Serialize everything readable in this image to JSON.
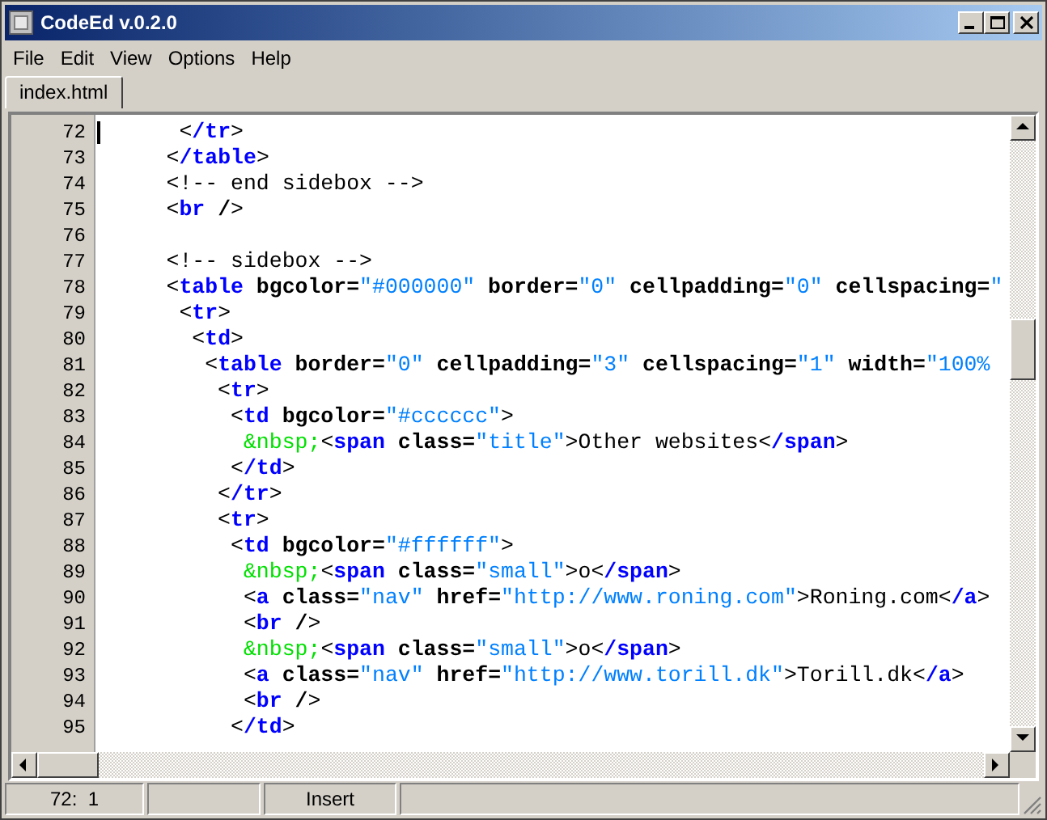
{
  "window": {
    "title": "CodeEd v.0.2.0"
  },
  "menu": [
    {
      "label": "File"
    },
    {
      "label": "Edit"
    },
    {
      "label": "View"
    },
    {
      "label": "Options"
    },
    {
      "label": "Help"
    }
  ],
  "tabs": [
    {
      "label": "index.html",
      "selected": true
    }
  ],
  "editor": {
    "lines": [
      {
        "number": "72",
        "tokens": [
          {
            "kind": "punct",
            "text": "      <"
          },
          {
            "kind": "tag",
            "text": "/tr"
          },
          {
            "kind": "punct",
            "text": ">"
          }
        ]
      },
      {
        "number": "73",
        "tokens": [
          {
            "kind": "punct",
            "text": "     <"
          },
          {
            "kind": "tag",
            "text": "/table"
          },
          {
            "kind": "punct",
            "text": ">"
          }
        ]
      },
      {
        "number": "74",
        "tokens": [
          {
            "kind": "text",
            "text": "     <!-- end sidebox -->"
          }
        ]
      },
      {
        "number": "75",
        "tokens": [
          {
            "kind": "punct",
            "text": "     <"
          },
          {
            "kind": "tag",
            "text": "br"
          },
          {
            "kind": "attr",
            "text": " /"
          },
          {
            "kind": "punct",
            "text": ">"
          }
        ]
      },
      {
        "number": "76"
      },
      {
        "number": "77",
        "tokens": [
          {
            "kind": "text",
            "text": "     <!-- sidebox -->"
          }
        ]
      },
      {
        "number": "78",
        "tokens": [
          {
            "kind": "punct",
            "text": "     <"
          },
          {
            "kind": "tag",
            "text": "table"
          },
          {
            "kind": "attr",
            "text": " bgcolor="
          },
          {
            "kind": "string",
            "text": "\"#000000\""
          },
          {
            "kind": "attr",
            "text": " border="
          },
          {
            "kind": "string",
            "text": "\"0\""
          },
          {
            "kind": "attr",
            "text": " cellpadding="
          },
          {
            "kind": "string",
            "text": "\"0\""
          },
          {
            "kind": "attr",
            "text": " cellspacing="
          },
          {
            "kind": "string",
            "text": "\""
          }
        ]
      },
      {
        "number": "79",
        "tokens": [
          {
            "kind": "punct",
            "text": "      <"
          },
          {
            "kind": "tag",
            "text": "tr"
          },
          {
            "kind": "punct",
            "text": ">"
          }
        ]
      },
      {
        "number": "80",
        "tokens": [
          {
            "kind": "punct",
            "text": "       <"
          },
          {
            "kind": "tag",
            "text": "td"
          },
          {
            "kind": "punct",
            "text": ">"
          }
        ]
      },
      {
        "number": "81",
        "tokens": [
          {
            "kind": "punct",
            "text": "        <"
          },
          {
            "kind": "tag",
            "text": "table"
          },
          {
            "kind": "attr",
            "text": " border="
          },
          {
            "kind": "string",
            "text": "\"0\""
          },
          {
            "kind": "attr",
            "text": " cellpadding="
          },
          {
            "kind": "string",
            "text": "\"3\""
          },
          {
            "kind": "attr",
            "text": " cellspacing="
          },
          {
            "kind": "string",
            "text": "\"1\""
          },
          {
            "kind": "attr",
            "text": " width="
          },
          {
            "kind": "string",
            "text": "\"100%"
          }
        ]
      },
      {
        "number": "82",
        "tokens": [
          {
            "kind": "punct",
            "text": "         <"
          },
          {
            "kind": "tag",
            "text": "tr"
          },
          {
            "kind": "punct",
            "text": ">"
          }
        ]
      },
      {
        "number": "83",
        "tokens": [
          {
            "kind": "punct",
            "text": "          <"
          },
          {
            "kind": "tag",
            "text": "td"
          },
          {
            "kind": "attr",
            "text": " bgcolor="
          },
          {
            "kind": "string",
            "text": "\"#cccccc\""
          },
          {
            "kind": "punct",
            "text": ">"
          }
        ]
      },
      {
        "number": "84",
        "tokens": [
          {
            "kind": "entity",
            "text": "           &nbsp;"
          },
          {
            "kind": "punct",
            "text": "<"
          },
          {
            "kind": "tag",
            "text": "span"
          },
          {
            "kind": "attr",
            "text": " class="
          },
          {
            "kind": "string",
            "text": "\"title\""
          },
          {
            "kind": "text",
            "text": ">Other websites<"
          },
          {
            "kind": "tag",
            "text": "/span"
          },
          {
            "kind": "punct",
            "text": ">"
          }
        ]
      },
      {
        "number": "85",
        "tokens": [
          {
            "kind": "punct",
            "text": "          <"
          },
          {
            "kind": "tag",
            "text": "/td"
          },
          {
            "kind": "punct",
            "text": ">"
          }
        ]
      },
      {
        "number": "86",
        "tokens": [
          {
            "kind": "punct",
            "text": "         <"
          },
          {
            "kind": "tag",
            "text": "/tr"
          },
          {
            "kind": "punct",
            "text": ">"
          }
        ]
      },
      {
        "number": "87",
        "tokens": [
          {
            "kind": "punct",
            "text": "         <"
          },
          {
            "kind": "tag",
            "text": "tr"
          },
          {
            "kind": "punct",
            "text": ">"
          }
        ]
      },
      {
        "number": "88",
        "tokens": [
          {
            "kind": "punct",
            "text": "          <"
          },
          {
            "kind": "tag",
            "text": "td"
          },
          {
            "kind": "attr",
            "text": " bgcolor="
          },
          {
            "kind": "string",
            "text": "\"#ffffff\""
          },
          {
            "kind": "punct",
            "text": ">"
          }
        ]
      },
      {
        "number": "89",
        "tokens": [
          {
            "kind": "entity",
            "text": "           &nbsp;"
          },
          {
            "kind": "punct",
            "text": "<"
          },
          {
            "kind": "tag",
            "text": "span"
          },
          {
            "kind": "attr",
            "text": " class="
          },
          {
            "kind": "string",
            "text": "\"small\""
          },
          {
            "kind": "text",
            "text": ">o<"
          },
          {
            "kind": "tag",
            "text": "/span"
          },
          {
            "kind": "punct",
            "text": ">"
          }
        ]
      },
      {
        "number": "90",
        "tokens": [
          {
            "kind": "punct",
            "text": "           <"
          },
          {
            "kind": "tag",
            "text": "a"
          },
          {
            "kind": "attr",
            "text": " class="
          },
          {
            "kind": "string",
            "text": "\"nav\""
          },
          {
            "kind": "attr",
            "text": " href="
          },
          {
            "kind": "string",
            "text": "\"http://www.roning.com\""
          },
          {
            "kind": "text",
            "text": ">Roning.com<"
          },
          {
            "kind": "tag",
            "text": "/a"
          },
          {
            "kind": "punct",
            "text": ">"
          }
        ]
      },
      {
        "number": "91",
        "tokens": [
          {
            "kind": "punct",
            "text": "           <"
          },
          {
            "kind": "tag",
            "text": "br"
          },
          {
            "kind": "attr",
            "text": " /"
          },
          {
            "kind": "punct",
            "text": ">"
          }
        ]
      },
      {
        "number": "92",
        "tokens": [
          {
            "kind": "entity",
            "text": "           &nbsp;"
          },
          {
            "kind": "punct",
            "text": "<"
          },
          {
            "kind": "tag",
            "text": "span"
          },
          {
            "kind": "attr",
            "text": " class="
          },
          {
            "kind": "string",
            "text": "\"small\""
          },
          {
            "kind": "text",
            "text": ">o<"
          },
          {
            "kind": "tag",
            "text": "/span"
          },
          {
            "kind": "punct",
            "text": ">"
          }
        ]
      },
      {
        "number": "93",
        "tokens": [
          {
            "kind": "punct",
            "text": "           <"
          },
          {
            "kind": "tag",
            "text": "a"
          },
          {
            "kind": "attr",
            "text": " class="
          },
          {
            "kind": "string",
            "text": "\"nav\""
          },
          {
            "kind": "attr",
            "text": " href="
          },
          {
            "kind": "string",
            "text": "\"http://www.torill.dk\""
          },
          {
            "kind": "text",
            "text": ">Torill.dk<"
          },
          {
            "kind": "tag",
            "text": "/a"
          },
          {
            "kind": "punct",
            "text": ">"
          }
        ]
      },
      {
        "number": "94",
        "tokens": [
          {
            "kind": "punct",
            "text": "           <"
          },
          {
            "kind": "tag",
            "text": "br"
          },
          {
            "kind": "attr",
            "text": " /"
          },
          {
            "kind": "punct",
            "text": ">"
          }
        ]
      },
      {
        "number": "95",
        "tokens": [
          {
            "kind": "punct",
            "text": "          <"
          },
          {
            "kind": "tag",
            "text": "/td"
          },
          {
            "kind": "punct",
            "text": ">"
          }
        ]
      }
    ]
  },
  "status_bar": {
    "position": "72:  1",
    "mode": "Insert"
  }
}
